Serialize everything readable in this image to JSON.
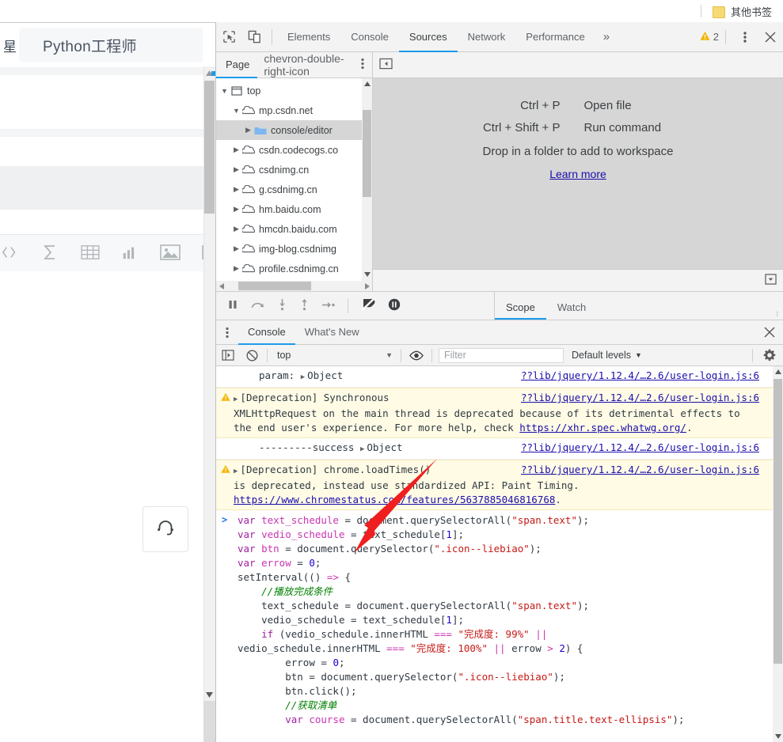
{
  "browser": {
    "bookmark_folder_label": "其他书签",
    "folder_icon": "folder-icon"
  },
  "page": {
    "left_truncated_char": "星",
    "search_value": "Python工程师",
    "toolbar_icons": [
      "code-icon",
      "sigma-icon",
      "table-icon",
      "bar-chart-icon",
      "image-icon",
      "card-icon"
    ],
    "support_icon": "headset-icon"
  },
  "devtools": {
    "toolbar": {
      "inspect_icon": "inspect-element-icon",
      "device_icon": "device-toolbar-icon",
      "more_tabs_label": "»",
      "warning_count": "2",
      "warning_icon": "warning-triangle-icon",
      "menu_icon": "vertical-dots-icon",
      "close_icon": "close-icon"
    },
    "tabs": [
      {
        "label": "Elements",
        "active": false
      },
      {
        "label": "Console",
        "active": false
      },
      {
        "label": "Sources",
        "active": true
      },
      {
        "label": "Network",
        "active": false
      },
      {
        "label": "Performance",
        "active": false
      }
    ],
    "navigator": {
      "tabs": [
        {
          "label": "Page",
          "active": true
        }
      ],
      "more_icon": "chevron-double-right-icon",
      "menu_icon": "vertical-dots-icon",
      "tree": [
        {
          "label": "top",
          "depth": 0,
          "icon": "frame-icon",
          "twisty": "open",
          "selected": false
        },
        {
          "label": "mp.csdn.net",
          "depth": 1,
          "icon": "cloud-icon",
          "twisty": "open",
          "selected": false
        },
        {
          "label": "console/editor",
          "depth": 2,
          "icon": "folder-blue-icon",
          "twisty": "closed",
          "selected": true
        },
        {
          "label": "csdn.codecogs.co",
          "depth": 1,
          "icon": "cloud-icon",
          "twisty": "closed",
          "selected": false
        },
        {
          "label": "csdnimg.cn",
          "depth": 1,
          "icon": "cloud-icon",
          "twisty": "closed",
          "selected": false
        },
        {
          "label": "g.csdnimg.cn",
          "depth": 1,
          "icon": "cloud-icon",
          "twisty": "closed",
          "selected": false
        },
        {
          "label": "hm.baidu.com",
          "depth": 1,
          "icon": "cloud-icon",
          "twisty": "closed",
          "selected": false
        },
        {
          "label": "hmcdn.baidu.com",
          "depth": 1,
          "icon": "cloud-icon",
          "twisty": "closed",
          "selected": false
        },
        {
          "label": "img-blog.csdnimg",
          "depth": 1,
          "icon": "cloud-icon",
          "twisty": "closed",
          "selected": false
        },
        {
          "label": "profile.csdnimg.cn",
          "depth": 1,
          "icon": "cloud-icon",
          "twisty": "closed",
          "selected": false
        }
      ]
    },
    "editor": {
      "show_navigator_icon": "show-navigator-icon",
      "welcome": {
        "shortcut_1_key": "Ctrl + P",
        "shortcut_1_action": "Open file",
        "shortcut_2_key": "Ctrl + Shift + P",
        "shortcut_2_action": "Run command",
        "drop_hint": "Drop in a folder to add to workspace",
        "learn_more": "Learn more"
      },
      "bottom_toggle_icon": "show-console-drawer-icon"
    },
    "debugger_toolbar": {
      "icons": [
        "pause-icon",
        "step-over-icon",
        "step-into-icon",
        "step-out-icon",
        "step-icon",
        "deactivate-breakpoints-icon",
        "pause-on-exceptions-icon"
      ]
    },
    "scope_tabs": [
      {
        "label": "Scope",
        "active": true
      },
      {
        "label": "Watch",
        "active": false
      }
    ],
    "drawer": {
      "menu_icon": "vertical-dots-icon",
      "tabs": [
        {
          "label": "Console",
          "active": true
        },
        {
          "label": "What's New",
          "active": false
        }
      ],
      "close_icon": "close-icon",
      "toolbar": {
        "sidebar_icon": "console-sidebar-icon",
        "clear_icon": "clear-console-icon",
        "context": "top",
        "context_caret": "▼",
        "eye_icon": "live-expression-icon",
        "filter_placeholder": "Filter",
        "levels_label": "Default levels",
        "levels_caret": "▼",
        "settings_icon": "gear-icon"
      }
    },
    "console_messages": [
      {
        "type": "log",
        "expandable": true,
        "text_prefix": "param: ",
        "object_label": "Object",
        "source": "??lib/jquery/1.12.4/…2.6/user-login.js:6"
      },
      {
        "type": "warning",
        "expandable": true,
        "head": "[Deprecation] Synchronous",
        "source": "??lib/jquery/1.12.4/…2.6/user-login.js:6",
        "body": "XMLHttpRequest on the main thread is deprecated because of its detrimental effects to the end user's experience. For more help, check ",
        "body_link": "https://xhr.spec.whatwg.org/",
        "body_tail": "."
      },
      {
        "type": "log",
        "expandable": true,
        "text_prefix": "---------success ",
        "object_label": "Object",
        "source": "??lib/jquery/1.12.4/…2.6/user-login.js:6"
      },
      {
        "type": "warning",
        "expandable": true,
        "head": "[Deprecation] chrome.loadTimes()",
        "source": "??lib/jquery/1.12.4/…2.6/user-login.js:6",
        "body": "is deprecated, instead use standardized API: Paint Timing. ",
        "body_link": "https://www.chromestatus.com/features/5637885046816768",
        "body_tail": "."
      }
    ],
    "console_prompt": {
      "caret": ">",
      "code_lines": [
        "var text_schedule = document.querySelectorAll(\"span.text\");",
        "var vedio_schedule = text_schedule[1];",
        "var btn = document.querySelector(\".icon--liebiao\");",
        "var errow = 0;",
        "setInterval(() => {",
        "    //播放完成条件",
        "    text_schedule = document.querySelectorAll(\"span.text\");",
        "    vedio_schedule = text_schedule[1];",
        "    if (vedio_schedule.innerHTML === \"完成度: 99%\" ||",
        "vedio_schedule.innerHTML === \"完成度: 100%\" || errow > 2) {",
        "        errow = 0;",
        "        btn = document.querySelector(\".icon--liebiao\");",
        "        btn.click();",
        "        //获取清单",
        "        var course = document.querySelectorAll(\"span.title.text-ellipsis\");"
      ]
    }
  },
  "annotation": {
    "arrow_color": "#ef1f1f",
    "arrow_name": "red-pointer-arrow"
  }
}
